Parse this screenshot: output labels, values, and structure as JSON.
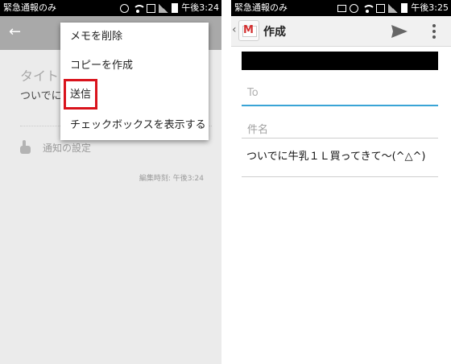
{
  "left": {
    "status": {
      "carrier": "緊急通報のみ",
      "time": "午後3:24"
    },
    "note": {
      "title_placeholder": "タイト",
      "body_text": "ついでに",
      "reminder_label": "通知の設定",
      "edited_time": "編集時刻: 午後3:24"
    },
    "menu": {
      "items": [
        {
          "label": "メモを削除"
        },
        {
          "label": "コピーを作成"
        },
        {
          "label": "送信"
        },
        {
          "label": "チェックボックスを表示する"
        }
      ]
    }
  },
  "right": {
    "status": {
      "carrier": "緊急通報のみ",
      "time": "午後3:25"
    },
    "appbar": {
      "title": "作成"
    },
    "compose": {
      "to_placeholder": "To",
      "subject_placeholder": "件名",
      "body": "ついでに牛乳１Ｌ買ってきて〜(^△^)"
    }
  },
  "colors": {
    "highlight": "#d9131c",
    "to_field_accent": "#3aa4d6",
    "status_bar": "#000000"
  }
}
